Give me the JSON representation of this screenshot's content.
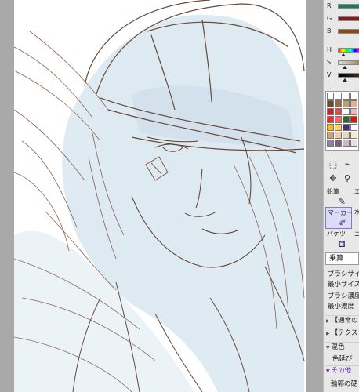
{
  "color_sliders": [
    {
      "label": "R",
      "color": "#1e7a52"
    },
    {
      "label": "G",
      "color": "#8a1a1a"
    },
    {
      "label": "B",
      "color": "#8a4a10"
    }
  ],
  "hsv_sliders": [
    {
      "label": "H",
      "color": "hue"
    },
    {
      "label": "S",
      "color": "#a08878"
    },
    {
      "label": "V",
      "color": "#3a2a22"
    }
  ],
  "palette_colors": [
    "#ffffff",
    "#ffffff",
    "#ffffff",
    "#ffffff",
    "#6b4a2e",
    "#9a6a3e",
    "#c49a6a",
    "#d9b48c",
    "#cc2222",
    "#e04a4a",
    "#ffffff",
    "#f2b8b8",
    "#e83030",
    "#ff6666",
    "#2a6e2a",
    "#d01818",
    "#f0c018",
    "#f6d860",
    "#4a2a7a",
    "#ffffff",
    "#d8a070",
    "#f2c8a8",
    "#e8d4b8",
    "#f8e8d8",
    "#9080a8",
    "#806070",
    "#c8b8c8",
    "#e8dce8"
  ],
  "tools": {
    "pencil_label": "鉛筆",
    "eraser_label": "エ",
    "marker_label": "マーカー",
    "watercolor_label": "水",
    "bucket_label": "バケツ",
    "other_label": "ニ"
  },
  "blend_mode": "乗算",
  "brush_props": [
    "ブラシサイズ",
    "最小サイズ",
    "ブラシ濃度",
    "最小濃度"
  ],
  "sections": {
    "normal_label": "【通常の",
    "texture_label": "【テクスチ",
    "mix_label": "混色",
    "extend_label": "色延び",
    "other_label": "その他",
    "outline_label": "輪郭の硬"
  }
}
